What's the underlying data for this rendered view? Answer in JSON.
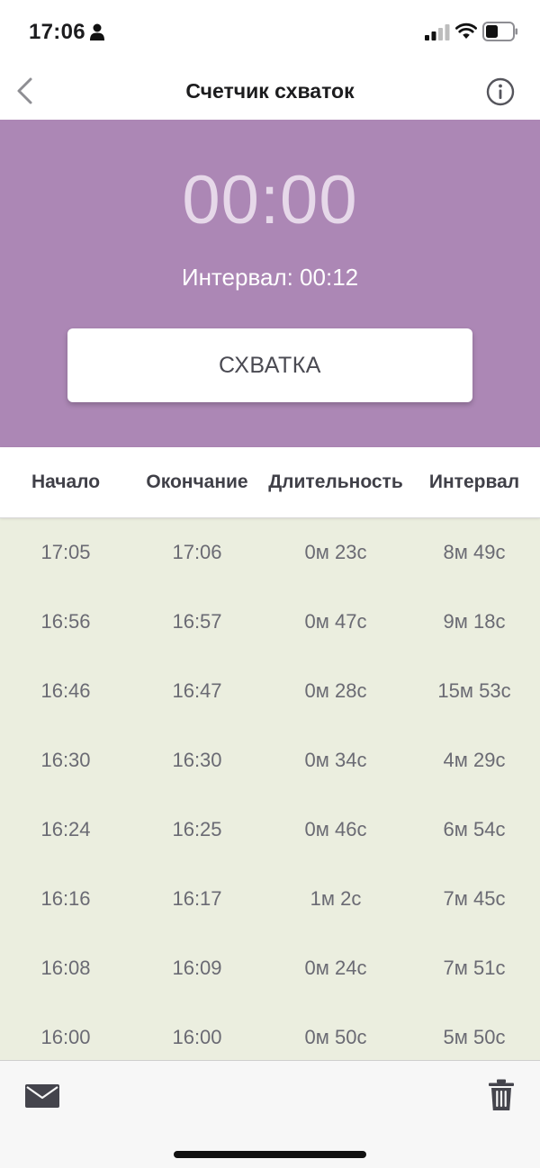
{
  "status_bar": {
    "time": "17:06",
    "icons": [
      "person-icon",
      "signal-icon",
      "wifi-icon",
      "battery-icon"
    ]
  },
  "nav": {
    "title": "Счетчик схваток",
    "back_icon": "chevron-left-icon",
    "info_icon": "info-icon"
  },
  "timer": {
    "display": "00:00",
    "interval_text": "Интервал: 00:12",
    "button_label": "СХВАТКА"
  },
  "table": {
    "headers": [
      "Начало",
      "Окончание",
      "Длительность",
      "Интервал"
    ],
    "rows": [
      [
        "17:05",
        "17:06",
        "0м 23с",
        "8м 49с"
      ],
      [
        "16:56",
        "16:57",
        "0м 47с",
        "9м 18с"
      ],
      [
        "16:46",
        "16:47",
        "0м 28с",
        "15м 53с"
      ],
      [
        "16:30",
        "16:30",
        "0м 34с",
        "4м 29с"
      ],
      [
        "16:24",
        "16:25",
        "0м 46с",
        "6м 54с"
      ],
      [
        "16:16",
        "16:17",
        "1м 2с",
        "7м 45с"
      ],
      [
        "16:08",
        "16:09",
        "0м 24с",
        "7м 51с"
      ],
      [
        "16:00",
        "16:00",
        "0м 50с",
        "5м 50с"
      ]
    ]
  },
  "toolbar": {
    "mail_icon": "mail-icon",
    "trash_icon": "trash-icon"
  },
  "colors": {
    "accent_purple": "#ac87b5",
    "list_background": "#ebeedf",
    "timer_text": "#e6d8e9"
  }
}
